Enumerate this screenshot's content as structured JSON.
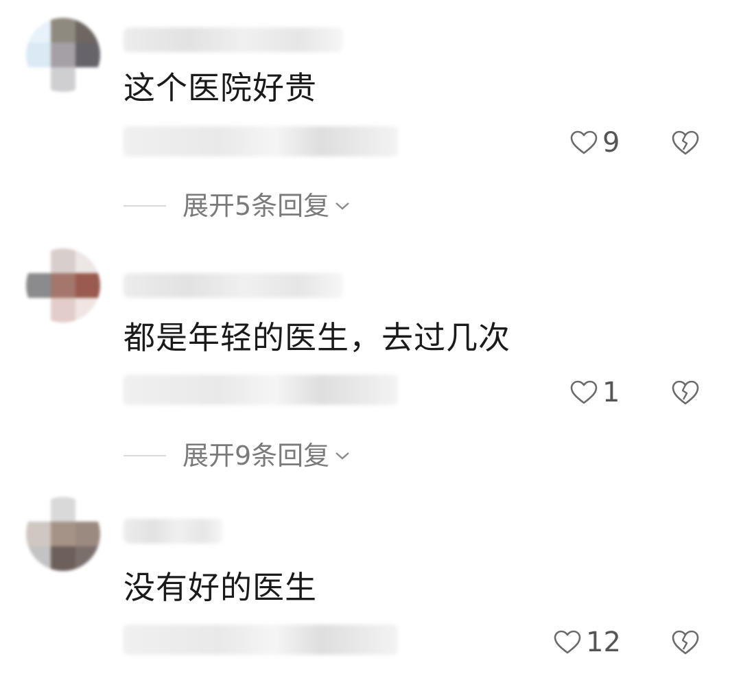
{
  "comments": [
    {
      "text": "这个医院好贵",
      "likes": "9",
      "expand_label": "展开5条回复",
      "avatar_colors": [
        "#e8f2fb",
        "#8f8a80",
        "#6e6660",
        "#dbe9f5",
        "#a59fa6",
        "#67636a",
        "#ffffff",
        "#cfcfd2",
        "#ffffff"
      ]
    },
    {
      "text": "都是年轻的医生，去过几次",
      "likes": "1",
      "expand_label": "展开9条回复",
      "avatar_colors": [
        "#ffffff",
        "#d8cfcd",
        "#ece6e4",
        "#8b8a8d",
        "#a4766c",
        "#9a5a50",
        "#ffffff",
        "#e3cdca",
        "#efe6e3"
      ]
    },
    {
      "text": "没有好的医生",
      "likes": "12",
      "avatar_colors": [
        "#ffffff",
        "#d9d9d9",
        "#ffffff",
        "#cfc7c2",
        "#a69388",
        "#9b8a80",
        "#c3c3c3",
        "#6d605c",
        "#7b6f6c"
      ]
    }
  ],
  "icons": {
    "like": "heart-outline-icon",
    "dislike": "broken-heart-icon",
    "expand": "chevron-down-icon"
  },
  "colors": {
    "text": "#1a1a1a",
    "muted": "#7a7a7a",
    "icon": "#555555"
  }
}
